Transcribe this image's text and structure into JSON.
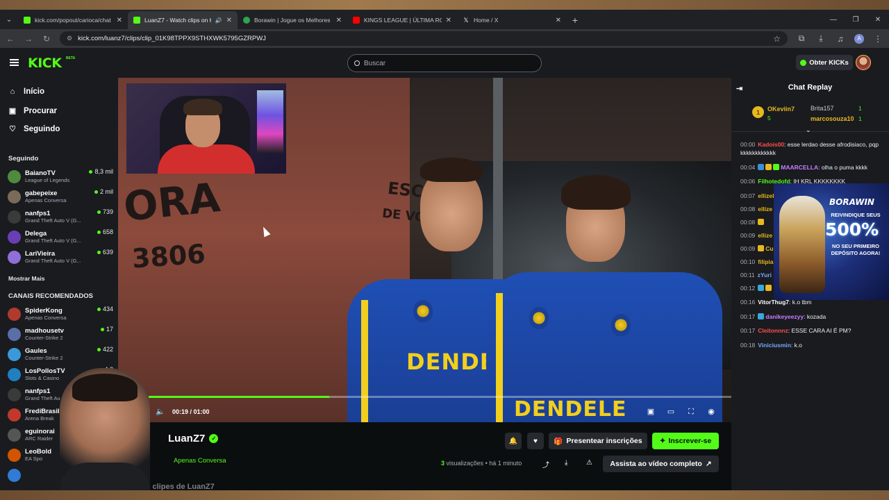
{
  "browser": {
    "tabs": [
      {
        "title": "kick.com/popout/carioca/chat",
        "favicon_color": "#53fc18",
        "active": false,
        "audio": false
      },
      {
        "title": "LuanZ7 - Watch clips on Kick",
        "favicon_color": "#53fc18",
        "active": true,
        "audio": true
      },
      {
        "title": "Borawin | Jogue os Melhores Slots",
        "favicon_color": "#2ea44f",
        "active": false,
        "audio": false
      },
      {
        "title": "KINGS LEAGUE | ÚLTIMA RO",
        "favicon_color": "#ff0000",
        "active": false,
        "audio": false
      },
      {
        "title": "Home / X",
        "favicon_color": "#ffffff",
        "active": false,
        "audio": false
      }
    ],
    "url": "kick.com/luanz7/clips/clip_01K98TPPX9STHXWK5795GZRPWJ",
    "profile_initial": "A"
  },
  "header": {
    "logo": "KICK",
    "beta": "BETA",
    "search_placeholder": "Buscar",
    "kicks_button": "Obter KICKs"
  },
  "sidebar": {
    "nav": [
      {
        "label": "Início",
        "icon": "home-icon"
      },
      {
        "label": "Procurar",
        "icon": "browse-icon"
      },
      {
        "label": "Seguindo",
        "icon": "heart-icon"
      }
    ],
    "following_title": "Seguindo",
    "following": [
      {
        "name": "BaianoTV",
        "category": "League of Legends",
        "viewers": "8,3 mil",
        "color": "#4f8b3c"
      },
      {
        "name": "gabepeixe",
        "category": "Apenas Conversa",
        "viewers": "2 mil",
        "color": "#7a6a5a"
      },
      {
        "name": "nanfps1",
        "category": "Grand Theft Auto V (G...",
        "viewers": "739",
        "color": "#3a3a3a"
      },
      {
        "name": "Delega",
        "category": "Grand Theft Auto V (G...",
        "viewers": "658",
        "color": "#6a3fb5"
      },
      {
        "name": "LariVieira",
        "category": "Grand Theft Auto V (G...",
        "viewers": "639",
        "color": "#8f6fd8"
      }
    ],
    "show_more": "Mostrar Mais",
    "recommended_title": "CANAIS RECOMENDADOS",
    "recommended": [
      {
        "name": "SpiderKong",
        "category": "Apenas Conversa",
        "viewers": "434",
        "color": "#b03a2e"
      },
      {
        "name": "madhousetv",
        "category": "Counter-Strike 2",
        "viewers": "17",
        "color": "#5a6fa8"
      },
      {
        "name": "Gaules",
        "category": "Counter-Strike 2",
        "viewers": "422",
        "color": "#3a9ad9"
      },
      {
        "name": "LosPollosTV",
        "category": "Slots & Casino",
        "viewers": "4,2",
        "color": "#1f7fbf"
      },
      {
        "name": "nanfps1",
        "category": "Grand Theft Au",
        "viewers": "",
        "color": "#3a3a3a"
      },
      {
        "name": "FrediBrasil",
        "category": "Arena Break",
        "viewers": "",
        "color": "#c0392b"
      },
      {
        "name": "eguinorai",
        "category": "ARC Raider",
        "viewers": "",
        "color": "#555555"
      },
      {
        "name": "LeoBold",
        "category": "EA Spo",
        "viewers": "",
        "color": "#d35400"
      },
      {
        "name": "",
        "category": "",
        "viewers": "",
        "color": "#2f7bd6"
      }
    ]
  },
  "video": {
    "wall_text_1": "ORA",
    "wall_text_2": "3806",
    "wall_text_3": "ESCOLA",
    "wall_text_4": "DE VOLEI",
    "shirt_text": "DENDELE",
    "time_current": "00:19",
    "time_total": "01:00",
    "progress": 0.31
  },
  "clip": {
    "author": "LuanZ7",
    "category": "Apenas Conversa",
    "gift_button": "Presentear inscrições",
    "subscribe_button": "Inscrever-se",
    "views_count": "3",
    "views_label": "visualizações",
    "posted": "há 1 minuto",
    "full_video_button": "Assista ao vídeo completo",
    "more_clips": "Mais clipes de LuanZ7"
  },
  "chat": {
    "title": "Chat Replay",
    "leaderboard": [
      {
        "rank": "1",
        "name": "OKeviin7",
        "count": "5",
        "color": "#e8b91f"
      },
      {
        "name": "Brita157",
        "count": "1",
        "color": "#c9c9c9"
      },
      {
        "name": "marcosouza10",
        "count": "1",
        "color": "#e8b91f"
      }
    ],
    "messages": [
      {
        "time": "00:00",
        "user": "Kadois00",
        "user_color": "#ff4f4f",
        "text": ": esse lerdao desse afrodisiaco, pqp kkkkkkkkkkkk"
      },
      {
        "time": "00:04",
        "user": "MAARCELLA",
        "user_color": "#c77dff",
        "text": ": olha o puma kkkk"
      },
      {
        "time": "00:06",
        "user": "Filhotedofd",
        "user_color": "#53fc18",
        "text": ": IH KRL KKKKKKKK"
      },
      {
        "time": "00:07",
        "user": "ellizel",
        "user_color": "#e8b91f",
        "text": ""
      },
      {
        "time": "00:08",
        "user": "ellize",
        "user_color": "#e8b91f",
        "text": ""
      },
      {
        "time": "00:08",
        "user": "",
        "user_color": "#e8b91f",
        "text": ""
      },
      {
        "time": "00:09",
        "user": "ellize",
        "user_color": "#e8b91f",
        "text": ""
      },
      {
        "time": "00:09",
        "user": "Cu",
        "user_color": "#e8b91f",
        "text": ""
      },
      {
        "time": "00:10",
        "user": "filipia",
        "user_color": "#e8b91f",
        "text": ""
      },
      {
        "time": "00:11",
        "user": "zYuri",
        "user_color": "#7aa7ff",
        "text": ""
      },
      {
        "time": "00:12",
        "user": "",
        "user_color": "#ffffff",
        "text": ""
      },
      {
        "time": "00:16",
        "user": "VitorThug7",
        "user_color": "#ffffff",
        "text": ": k.o tbm"
      },
      {
        "time": "00:17",
        "user": "danikeyeezyy",
        "user_color": "#c77dff",
        "text": ": kozada"
      },
      {
        "time": "00:17",
        "user": "Cleitonnnz",
        "user_color": "#ff4f4f",
        "text": ": ESSE CARA AI É PM?"
      },
      {
        "time": "00:18",
        "user": "Viniciusmin",
        "user_color": "#7aa7ff",
        "text": ": k.o"
      }
    ],
    "ad": {
      "brand": "BORAWIN",
      "line1": "REIVINDIQUE SEUS",
      "big": "500%",
      "line2": "NO SEU PRIMEIRO DEPÓSITO AGORA!"
    }
  }
}
